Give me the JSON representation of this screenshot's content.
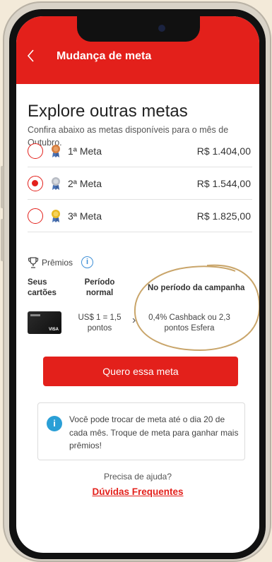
{
  "header": {
    "title": "Mudança de meta",
    "back_icon": "chevron-left-icon"
  },
  "main": {
    "heading": "Explore outras metas",
    "subtitle": "Confira abaixo as metas disponíveis para o mês de Outubro."
  },
  "metas": [
    {
      "label": "1ª Meta",
      "value": "R$ 1.404,00",
      "medal": "bronze-medal-icon",
      "selected": false
    },
    {
      "label": "2ª Meta",
      "value": "R$ 1.544,00",
      "medal": "silver-medal-icon",
      "selected": true
    },
    {
      "label": "3ª Meta",
      "value": "R$ 1.825,00",
      "medal": "gold-medal-icon",
      "selected": false
    }
  ],
  "premios": {
    "label": "Prêmios",
    "info_glyph": "i",
    "col_cards": "Seus cartões",
    "col_normal": "Período normal",
    "col_campaign": "No período da campanha",
    "normal_value": "US$ 1 = 1,5 pontos",
    "arrow": "›",
    "campaign_value": "0,4% Cashback ou 2,3 pontos Esfera",
    "card_brand": "VISA"
  },
  "cta": {
    "label": "Quero essa meta"
  },
  "note": {
    "glyph": "i",
    "text": "Você pode trocar de meta até o dia 20 de cada mês. Troque de meta para ganhar mais prêmios!"
  },
  "help": {
    "question": "Precisa de ajuda?",
    "link": "Dúvidas Frequentes"
  },
  "colors": {
    "brand": "#e3201b",
    "info": "#3e8fd6",
    "highlight_ellipse": "#c9a56a"
  }
}
